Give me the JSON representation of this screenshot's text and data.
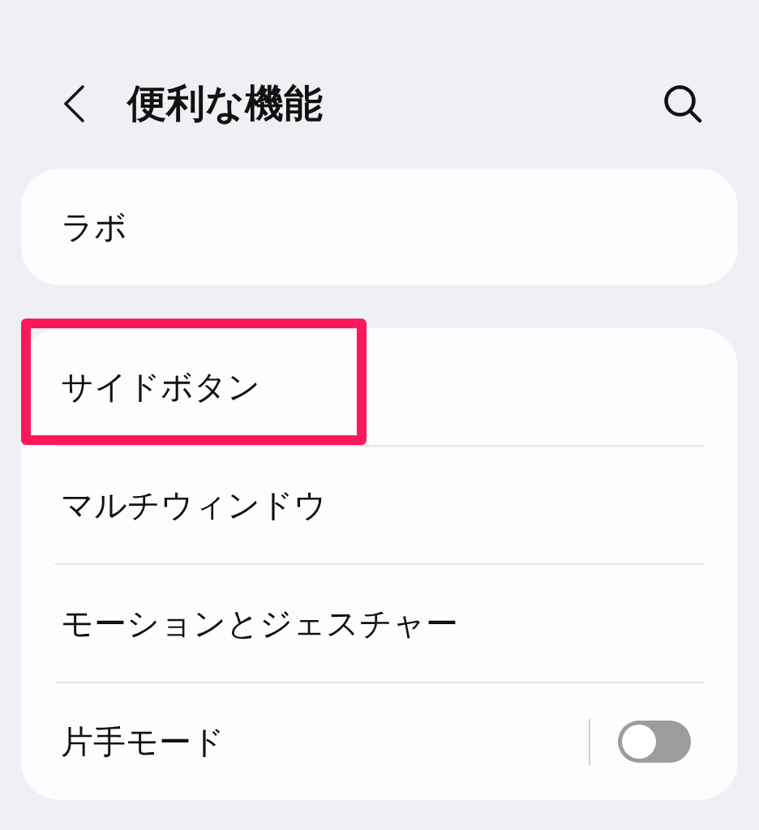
{
  "header": {
    "title": "便利な機能"
  },
  "groups": [
    {
      "items": [
        {
          "label": "ラボ",
          "kind": "link",
          "highlighted": false
        }
      ]
    },
    {
      "items": [
        {
          "label": "サイドボタン",
          "kind": "link",
          "highlighted": true
        },
        {
          "label": "マルチウィンドウ",
          "kind": "link",
          "highlighted": false
        },
        {
          "label": "モーションとジェスチャー",
          "kind": "link",
          "highlighted": false
        },
        {
          "label": "片手モード",
          "kind": "switch",
          "on": false,
          "highlighted": false
        }
      ]
    }
  ]
}
